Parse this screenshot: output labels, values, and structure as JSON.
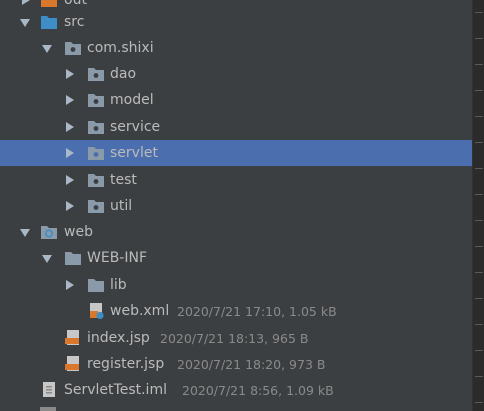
{
  "tree": {
    "items": [
      {
        "label": "out"
      },
      {
        "label": "src"
      },
      {
        "label": "com.shixi"
      },
      {
        "label": "dao"
      },
      {
        "label": "model"
      },
      {
        "label": "service"
      },
      {
        "label": "servlet"
      },
      {
        "label": "test"
      },
      {
        "label": "util"
      },
      {
        "label": "web"
      },
      {
        "label": "WEB-INF"
      },
      {
        "label": "lib"
      },
      {
        "label": "web.xml",
        "meta": "2020/7/21 17:10, 1.05 kB"
      },
      {
        "label": "index.jsp",
        "meta": "2020/7/21 18:13, 965 B"
      },
      {
        "label": "register.jsp",
        "meta": "2020/7/21 18:20, 973 B"
      },
      {
        "label": "ServletTest.iml",
        "meta": "2020/7/21 8:56, 1.09 kB"
      }
    ],
    "selected_label": "servlet"
  },
  "colors": {
    "background": "#3c3f41",
    "selection": "#4b6eaf",
    "folder": "#8a9aa8",
    "source_folder": "#3d8dc7",
    "out_folder": "#d9772c",
    "jsp_icon": "#d9772c"
  }
}
